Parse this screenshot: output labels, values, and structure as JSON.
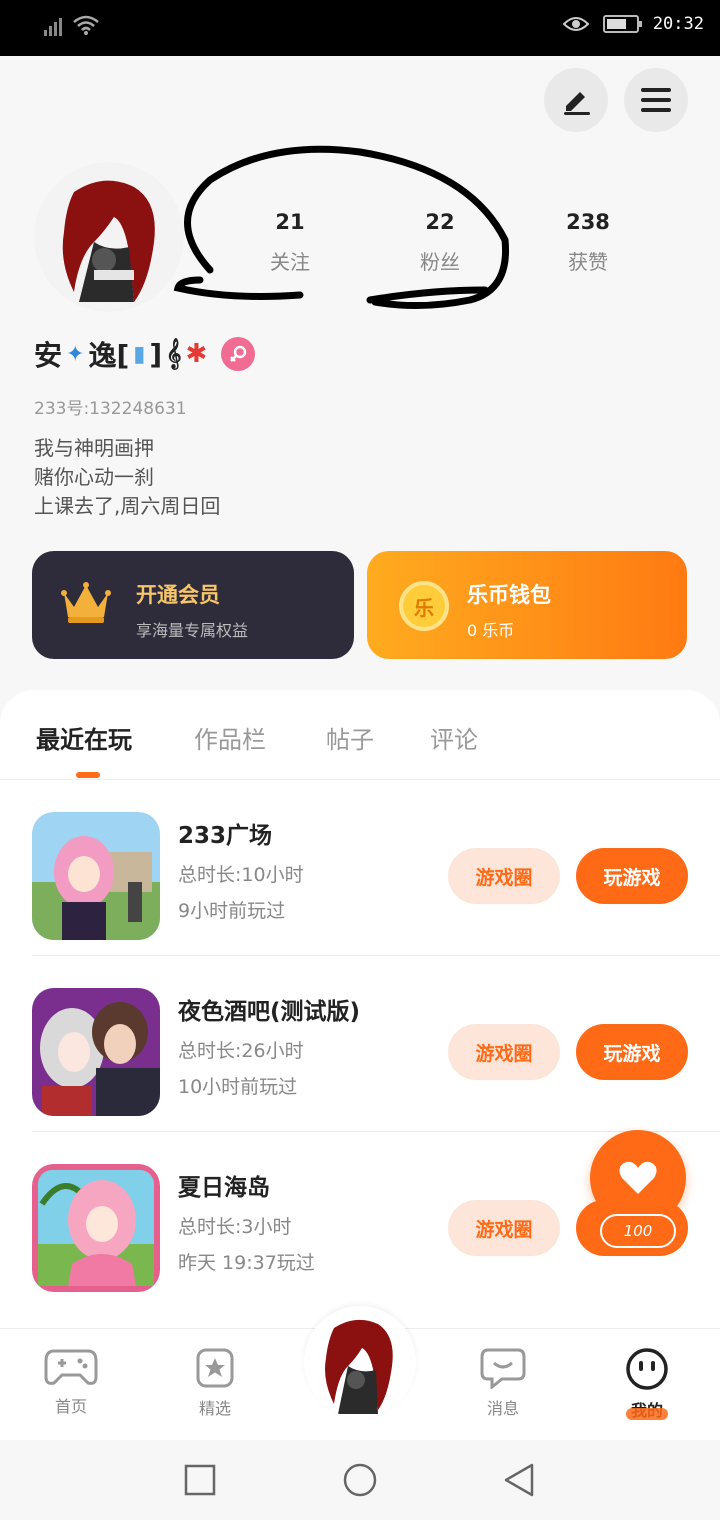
{
  "status_bar": {
    "time": "20:32"
  },
  "profile": {
    "stats": [
      {
        "num": "21",
        "label": "关注"
      },
      {
        "num": "22",
        "label": "粉丝"
      },
      {
        "num": "238",
        "label": "获赞"
      }
    ],
    "nickname_parts": [
      "安",
      "逸[",
      "]",
      "₹"
    ],
    "uid": "233号:132248631",
    "bio": [
      "我与神明画押",
      "赌你心动一刹",
      "上课去了,周六周日回"
    ]
  },
  "cards": {
    "vip": {
      "title": "开通会员",
      "subtitle": "享海量专属权益"
    },
    "wallet": {
      "title": "乐币钱包",
      "subtitle": "0 乐币",
      "coin": "乐"
    }
  },
  "tabs": [
    "最近在玩",
    "作品栏",
    "帖子",
    "评论"
  ],
  "games": [
    {
      "name": "233广场",
      "duration": "总时长:10小时",
      "last_played": "9小时前玩过",
      "circle_label": "游戏圈",
      "play_label": "玩游戏"
    },
    {
      "name": "夜色酒吧(测试版)",
      "duration": "总时长:26小时",
      "last_played": "10小时前玩过",
      "circle_label": "游戏圈",
      "play_label": "玩游戏"
    },
    {
      "name": "夏日海岛",
      "duration": "总时长:3小时",
      "last_played": "昨天 19:37玩过",
      "circle_label": "游戏圈",
      "play_label": "玩游戏"
    }
  ],
  "float_like": {
    "count": "100"
  },
  "bottom_nav": [
    {
      "label": "首页",
      "icon": "gamepad-icon"
    },
    {
      "label": "精选",
      "icon": "star-icon"
    },
    {
      "label": "",
      "icon": "avatar"
    },
    {
      "label": "消息",
      "icon": "message-icon"
    },
    {
      "label": "我的",
      "icon": "smiley-icon"
    }
  ],
  "colors": {
    "accent": "#ff6a17",
    "vip_bg": "#2e2b3a",
    "gold": "#f7c56b",
    "gender": "#f06c93"
  }
}
